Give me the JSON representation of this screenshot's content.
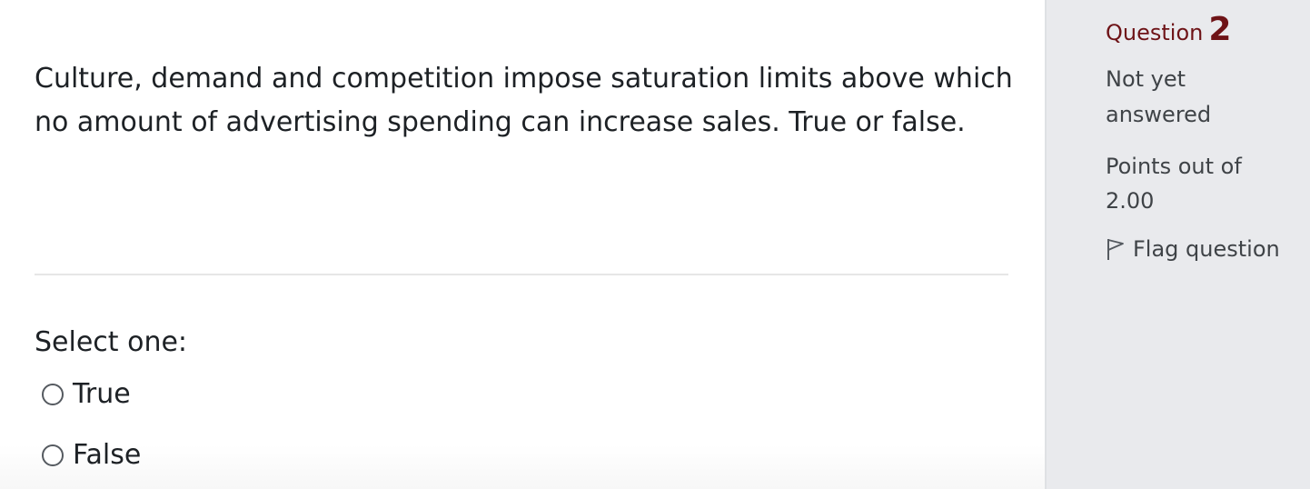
{
  "question": {
    "text": "Culture, demand and competition impose saturation limits above which no amount of advertising spending can increase sales. True or false.",
    "prompt": "Select one:",
    "options": [
      {
        "label": "True",
        "selected": false
      },
      {
        "label": "False",
        "selected": false
      }
    ]
  },
  "info": {
    "heading_label": "Question",
    "number": "2",
    "state": "Not yet answered",
    "grade_line1": "Points out of",
    "grade_line2": "2.00",
    "flag_label": "Flag question",
    "flag_icon": "flag-outline-icon"
  },
  "colors": {
    "accent": "#6e1317",
    "sidebar_bg": "#e9eaed",
    "text": "#1d2125",
    "muted_text": "#3f4347",
    "divider": "#e6e6e6"
  }
}
